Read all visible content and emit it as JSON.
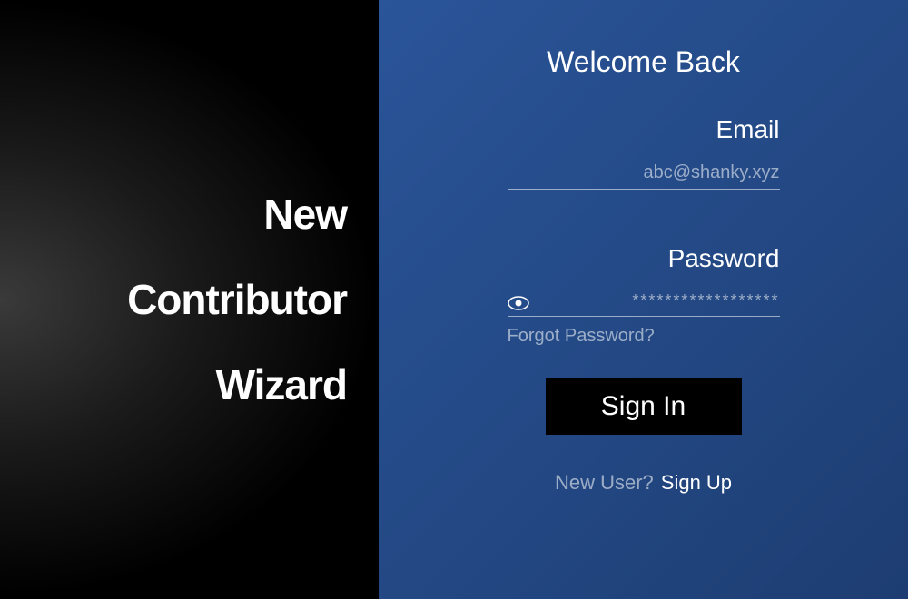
{
  "brand": {
    "line1": "New",
    "line2": "Contributor",
    "line3": "Wizard"
  },
  "form": {
    "heading": "Welcome Back",
    "email_label": "Email",
    "email_placeholder": "abc@shanky.xyz",
    "email_value": "",
    "password_label": "Password",
    "password_value": "",
    "password_placeholder": "******************",
    "forgot_label": "Forgot Password?",
    "signin_label": "Sign In",
    "signup_prefix": "New User?",
    "signup_label": "Sign Up"
  }
}
